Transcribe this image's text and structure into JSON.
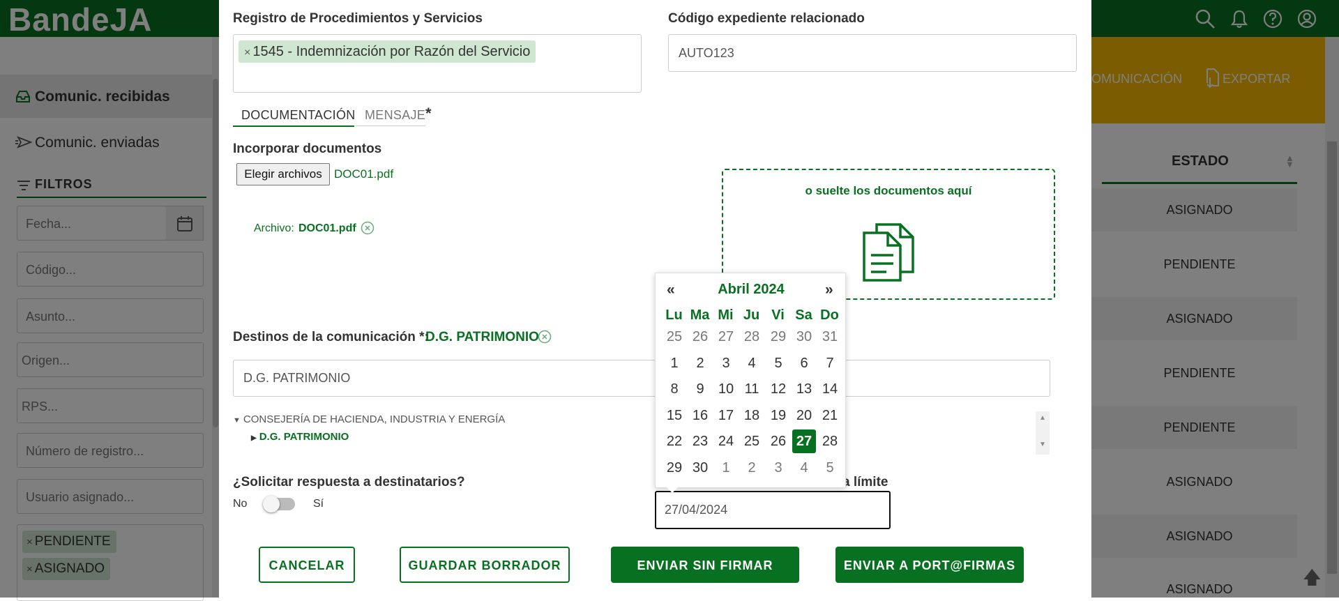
{
  "app": {
    "brand": "BandeJA"
  },
  "sidebar": {
    "received_label": "Comunic. recibidas",
    "sent_label": "Comunic. enviadas",
    "filters_title": "FILTROS",
    "filters": {
      "fecha": "Fecha...",
      "codigo": "Código...",
      "asunto": "Asunto...",
      "origen": "Origen...",
      "rps": "RPS...",
      "numero_registro": "Número de registro...",
      "usuario_asignado": "Usuario asignado..."
    },
    "status_tags": [
      "PENDIENTE",
      "ASIGNADO"
    ]
  },
  "toolbar": {
    "comunicacion_label": "OMUNICACIÓN",
    "exportar_label": "EXPORTAR"
  },
  "table": {
    "estado_header": "ESTADO",
    "rows": [
      "ASIGNADO",
      "PENDIENTE",
      "ASIGNADO",
      "PENDIENTE",
      "PENDIENTE",
      "ASIGNADO",
      "ASIGNADO",
      "ASIGNADO"
    ]
  },
  "modal": {
    "rps_label": "Registro de Procedimientos y Servicios",
    "rps_tag": "1545 - Indemnización por Razón del Servicio",
    "codigo_label": "Código expediente relacionado",
    "codigo_value": "AUTO123",
    "tabs": {
      "documentacion": "DOCUMENTACIÓN",
      "mensaje": "MENSAJE",
      "required_mark": "*"
    },
    "incorporar_label": "Incorporar documentos",
    "file_button": "Elegir archivos",
    "file_chosen": "DOC01.pdf",
    "archivo_prefix": "Archivo:",
    "archivo_name": "DOC01.pdf",
    "dropzone_text": "o suelte los documentos aquí",
    "destinos_label": "Destinos de la comunicación *:",
    "destinos_selected": "D.G. PATRIMONIO",
    "destinos_input": "D.G. PATRIMONIO",
    "tree_parent": "CONSEJERÍA DE HACIENDA, INDUSTRIA Y ENERGÍA",
    "tree_child": "D.G. PATRIMONIO",
    "respuesta_label": "¿Solicitar respuesta a destinatarios?",
    "toggle_no": "No",
    "toggle_si": "Sí",
    "fecha_limite_label_visible": "a límite",
    "fecha_value": "27/04/2024",
    "buttons": {
      "cancelar": "CANCELAR",
      "guardar": "GUARDAR BORRADOR",
      "enviar_sin_firmar": "ENVIAR SIN FIRMAR",
      "enviar_portafirmas": "ENVIAR A PORT@FIRMAS"
    }
  },
  "calendar": {
    "prev": "«",
    "next": "»",
    "month_label": "Abril 2024",
    "weekdays": [
      "Lu",
      "Ma",
      "Mi",
      "Ju",
      "Vi",
      "Sa",
      "Do"
    ],
    "weeks": [
      [
        "25",
        "26",
        "27",
        "28",
        "29",
        "30",
        "31"
      ],
      [
        "1",
        "2",
        "3",
        "4",
        "5",
        "6",
        "7"
      ],
      [
        "8",
        "9",
        "10",
        "11",
        "12",
        "13",
        "14"
      ],
      [
        "15",
        "16",
        "17",
        "18",
        "19",
        "20",
        "21"
      ],
      [
        "22",
        "23",
        "24",
        "25",
        "26",
        "27",
        "28"
      ],
      [
        "29",
        "30",
        "1",
        "2",
        "3",
        "4",
        "5"
      ]
    ],
    "selected_day": "27",
    "colors": {
      "accent": "#087021"
    }
  },
  "icons": [
    "search-icon",
    "bell-icon",
    "help-icon",
    "user-icon",
    "inbox-icon",
    "send-icon",
    "filter-icon",
    "calendar-icon",
    "documents-icon",
    "clear-icon",
    "export-icon",
    "arrow-up-icon"
  ]
}
